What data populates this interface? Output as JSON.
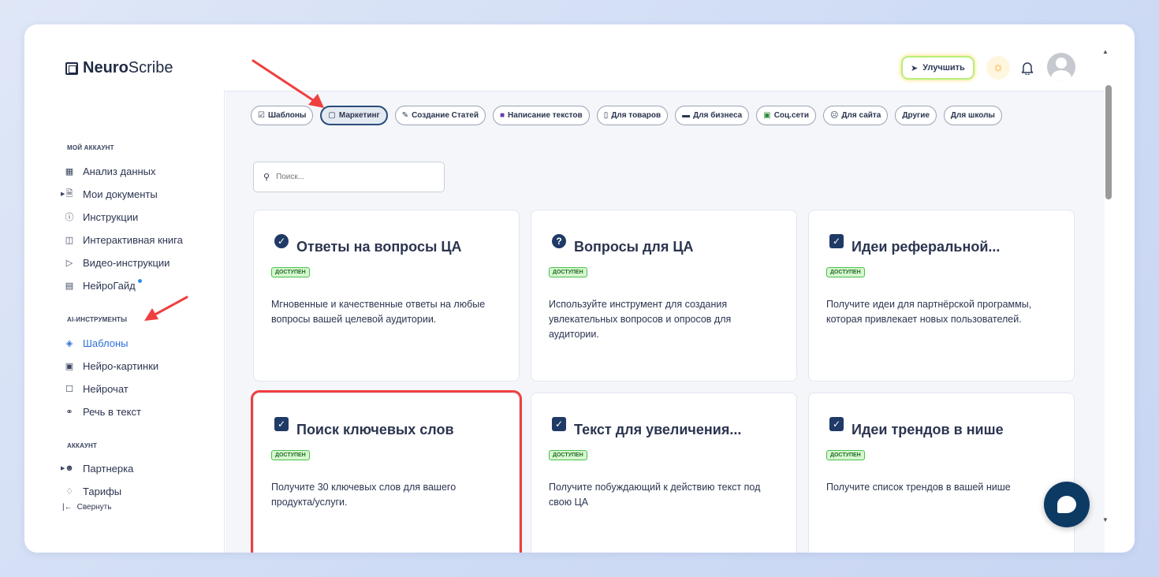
{
  "brand": {
    "bold": "Neuro",
    "light": "Scribe"
  },
  "header": {
    "upgrade_label": "Улучшить"
  },
  "sidebar": {
    "sections": {
      "account_mine": "МОЙ АККАУНТ",
      "ai_tools": "AI-ИНСТРУМЕНТЫ",
      "account": "АККАУНТ"
    },
    "items": [
      {
        "label": "Анализ данных",
        "icon": "grid-icon"
      },
      {
        "label": "Мои документы",
        "icon": "document-icon"
      },
      {
        "label": "Инструкции",
        "icon": "help-circle-icon"
      },
      {
        "label": "Интерактивная книга",
        "icon": "book-icon"
      },
      {
        "label": "Видео-инструкции",
        "icon": "video-icon"
      },
      {
        "label": "НейроГайд",
        "icon": "layout-icon"
      },
      {
        "label": "Шаблоны",
        "icon": "layers-icon"
      },
      {
        "label": "Нейро-картинки",
        "icon": "image-icon"
      },
      {
        "label": "Нейрочат",
        "icon": "chat-icon"
      },
      {
        "label": "Речь в текст",
        "icon": "headphones-icon"
      },
      {
        "label": "Партнерка",
        "icon": "users-icon"
      },
      {
        "label": "Тарифы",
        "icon": "tag-icon"
      }
    ],
    "collapse_label": "Свернуть"
  },
  "chips": [
    {
      "label": "Шаблоны",
      "icon": "checkbox-icon"
    },
    {
      "label": "Маркетинг",
      "icon": "square-icon"
    },
    {
      "label": "Создание Статей",
      "icon": "edit-icon"
    },
    {
      "label": "Написание текстов",
      "icon": "city-icon"
    },
    {
      "label": "Для товаров",
      "icon": "phone-icon"
    },
    {
      "label": "Для бизнеса",
      "icon": "laptop-icon"
    },
    {
      "label": "Соц.сети",
      "icon": "book-icon"
    },
    {
      "label": "Для сайта",
      "icon": "mask-icon"
    },
    {
      "label": "Другие",
      "icon": ""
    },
    {
      "label": "Для школы",
      "icon": ""
    }
  ],
  "search": {
    "placeholder": "Поиск..."
  },
  "badge_label": "ДОСТУПЕН",
  "cards": [
    {
      "title": "Ответы на вопросы ЦА",
      "description": "Мгновенные и качественные ответы на любые вопросы вашей целевой аудитории.",
      "icon": "check-circle-icon"
    },
    {
      "title": "Вопросы для ЦА",
      "description": "Используйте инструмент для создания увлекательных вопросов и опросов для аудитории.",
      "icon": "question-circle-icon"
    },
    {
      "title": "Идеи реферальной...",
      "description": "Получите идеи для партнёрской программы, которая привлекает новых пользователей.",
      "icon": "check-square-icon"
    },
    {
      "title": "Поиск ключевых слов",
      "description": "Получите 30 ключевых слов для вашего продукта/услуги.",
      "icon": "check-square-icon"
    },
    {
      "title": "Текст для увеличения...",
      "description": "Получите побуждающий к действию текст под свою ЦА",
      "icon": "check-square-icon"
    },
    {
      "title": "Идеи трендов в нише",
      "description": "Получите список трендов в вашей нише",
      "icon": "check-square-icon"
    }
  ],
  "colors": {
    "accent_blue": "#2c6fd6",
    "badge_green": "#49c04f",
    "highlight_red": "#ef3f3f",
    "fab": "#0d3a63"
  }
}
